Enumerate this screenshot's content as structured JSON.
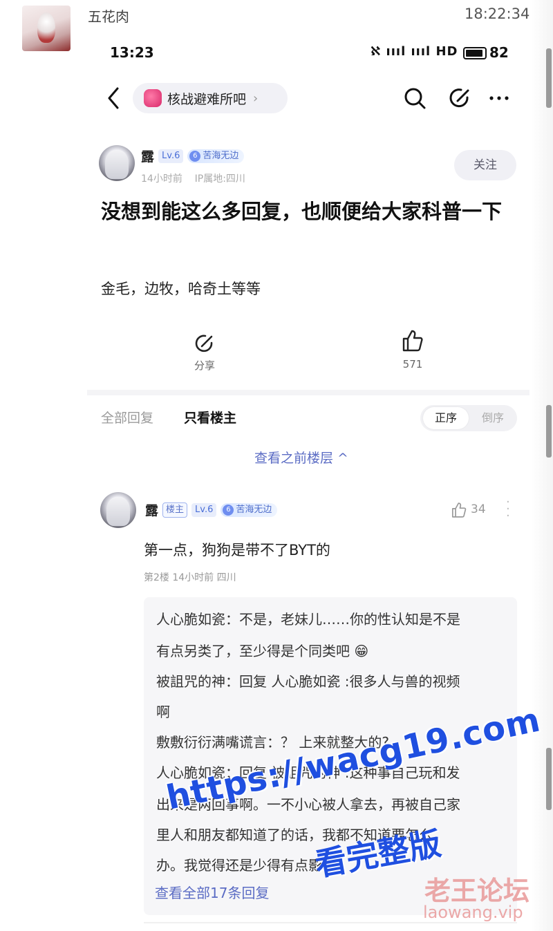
{
  "chat": {
    "sender_name": "五花肉",
    "timestamp": "18:22:34"
  },
  "status_bar": {
    "time": "13:23",
    "network": "ℵ ıııl ıııl HD",
    "battery": "82"
  },
  "nav": {
    "forum_name": "核战避难所吧",
    "forum_chevron": "›"
  },
  "post": {
    "author": {
      "name": "露",
      "level": "Lv.6",
      "badge_number": "6",
      "badge": "苦海无边",
      "time": "14小时前",
      "location": "IP属地:四川"
    },
    "follow_label": "关注",
    "title": "没想到能这么多回复，也顺便给大家科普一下",
    "body": "金毛，边牧，哈奇土等等",
    "share_label": "分享",
    "like_count": "571"
  },
  "tabs": {
    "all": "全部回复",
    "op_only": "只看楼主",
    "sort_asc": "正序",
    "sort_desc": "倒序",
    "prev_floors": "查看之前楼层 ^"
  },
  "reply": {
    "author": {
      "name": "露",
      "op_tag": "楼主",
      "level": "Lv.6",
      "badge_number": "6",
      "badge": "苦海无边"
    },
    "likes": "34",
    "text": "第一点，狗狗是带不了BYT的",
    "meta": "第2楼  14小时前  四川",
    "sub_replies": [
      "人心脆如瓷：不是，老妹儿……你的性认知是不是",
      "有点另类了，至少得是个同类吧 😁",
      "被詛咒的神：回复 人心脆如瓷 :很多人与兽的视频",
      "啊",
      "敷敷衍衍满嘴谎言：？ 上来就整大的?",
      "人心脆如瓷：回复 被詛咒的神 :这种事自己玩和发",
      "出来是两回事啊。一不小心被人拿去，再被自己家",
      "里人和朋友都知道了的话，我都不知道要怎么",
      "办。我觉得还是少得有点影"
    ],
    "see_all": "查看全部17条回复"
  },
  "watermarks": {
    "url": "https://wacg19.com",
    "full": "看完整版",
    "site_cn": "老王论坛",
    "site_en": "laowang.vip"
  },
  "colors": {
    "link": "#5b6cc4",
    "watermark_blue": "#1f4fe0",
    "watermark_pink": "#e99a9a"
  }
}
